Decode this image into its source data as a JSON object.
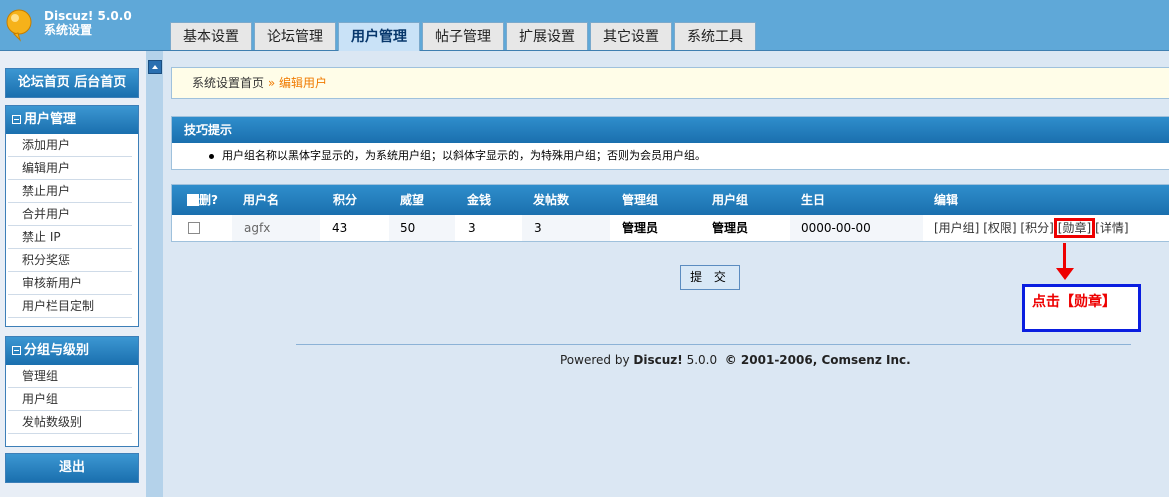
{
  "header": {
    "brand_line1": "Discuz! 5.0.0",
    "brand_line2": "系统设置",
    "tabs": [
      "基本设置",
      "论坛管理",
      "用户管理",
      "帖子管理",
      "扩展设置",
      "其它设置",
      "系统工具"
    ],
    "active_tab": "用户管理"
  },
  "sidebar": {
    "home_links": "论坛首页 后台首页",
    "user_section_title": "用户管理",
    "user_items": [
      "添加用户",
      "编辑用户",
      "禁止用户",
      "合并用户",
      "禁止 IP",
      "积分奖惩",
      "审核新用户",
      "用户栏目定制"
    ],
    "group_section_title": "分组与级别",
    "group_items": [
      "管理组",
      "用户组",
      "发帖数级别"
    ],
    "logout": "退出"
  },
  "breadcrumb": {
    "home": "系统设置首页",
    "sep": "»",
    "current": "编辑用户"
  },
  "tip": {
    "title": "技巧提示",
    "text": "用户组名称以黑体字显示的，为系统用户组；以斜体字显示的，为特殊用户组；否则为会员用户组。"
  },
  "table": {
    "headers": [
      "删?",
      "用户名",
      "积分",
      "威望",
      "金钱",
      "发帖数",
      "管理组",
      "用户组",
      "生日",
      "编辑"
    ],
    "rows": [
      {
        "username": "agfx",
        "credits": "43",
        "prestige": "50",
        "money": "3",
        "posts": "3",
        "admin_group": "管理员",
        "user_group": "管理员",
        "birthday": "0000-00-00",
        "edit_usergroup": "[用户组]",
        "edit_access": "[权限]",
        "edit_credits": "[积分]",
        "edit_medal": "[勋章]",
        "edit_detail": "[详情]"
      }
    ]
  },
  "submit_label": "提 交",
  "footer": {
    "powered_by": "Powered by",
    "product": "Discuz!",
    "version": "5.0.0",
    "copyright": "© 2001-2006, Comsenz Inc."
  },
  "annotation": {
    "callout": "点击【勋章】",
    "box_color": "#0a1ee0",
    "highlight_color": "#ee0000"
  },
  "colors": {
    "header_bg": "#5fa8d8",
    "section_header": "#1a6fae",
    "breadcrumb_accent": "#f07a00"
  }
}
